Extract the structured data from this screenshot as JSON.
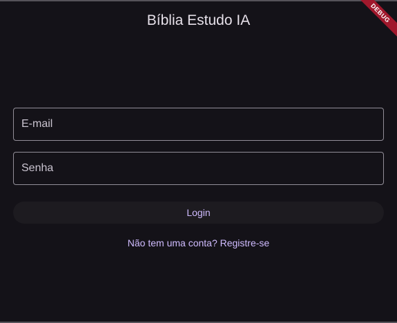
{
  "app": {
    "title": "Bíblia Estudo IA"
  },
  "form": {
    "email_placeholder": "E-mail",
    "password_placeholder": "Senha",
    "login_label": "Login",
    "register_link": "Não tem uma conta? Registre-se"
  },
  "banner": {
    "label": "DEBUG"
  },
  "colors": {
    "background": "#141218",
    "accent": "#d0bcff",
    "field_border": "#938f99",
    "banner": "#a0182c"
  }
}
